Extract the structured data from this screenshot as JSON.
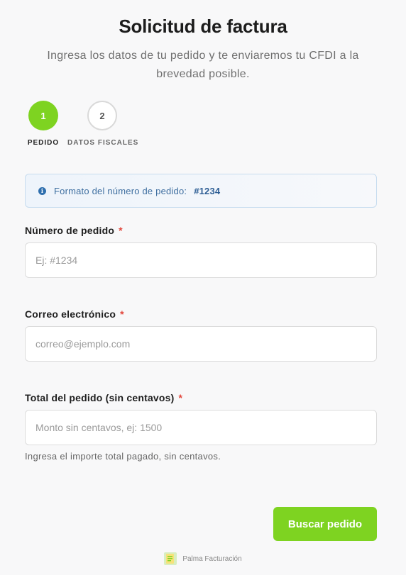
{
  "header": {
    "title": "Solicitud de factura",
    "subtitle": "Ingresa los datos de tu pedido y te enviaremos tu CFDI a la brevedad posible."
  },
  "steps": [
    {
      "number": "1",
      "label": "PEDIDO",
      "active": true
    },
    {
      "number": "2",
      "label": "DATOS FISCALES",
      "active": false
    }
  ],
  "info": {
    "icon": "info-icon",
    "text": "Formato del número de pedido:",
    "code": "#1234"
  },
  "form": {
    "order_number": {
      "label": "Número de pedido",
      "required_mark": "*",
      "placeholder": "Ej: #1234",
      "value": ""
    },
    "email": {
      "label": "Correo electrónico",
      "required_mark": "*",
      "placeholder": "correo@ejemplo.com",
      "value": ""
    },
    "total": {
      "label": "Total del pedido (sin centavos)",
      "required_mark": "*",
      "placeholder": "Monto sin centavos, ej: 1500",
      "value": "",
      "help": "Ingresa el importe total pagado, sin centavos."
    }
  },
  "actions": {
    "submit_label": "Buscar pedido"
  },
  "footer": {
    "brand": "Palma Facturación",
    "logo_icon": "palma-logo-icon"
  },
  "colors": {
    "accent": "#7ed321",
    "info_text": "#3f6fa0",
    "required": "#e2463b"
  }
}
